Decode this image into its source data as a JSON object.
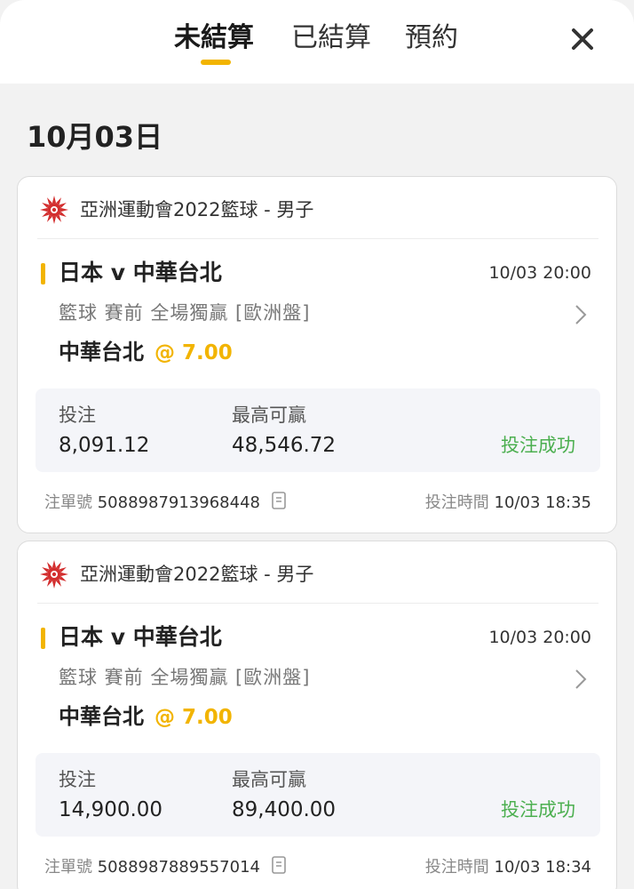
{
  "tabs": [
    {
      "label": "未結算",
      "active": true
    },
    {
      "label": "已結算",
      "active": false
    },
    {
      "label": "預約",
      "active": false
    }
  ],
  "date_heading": "10月03日",
  "colors": {
    "accent": "#f2b400",
    "success": "#4caf50",
    "league_icon": "#d32f2f"
  },
  "bets": [
    {
      "league": "亞洲運動會2022籃球 - 男子",
      "match": "日本 v 中華台北",
      "match_time": "10/03 20:00",
      "market": "籃球 賽前  全場獨贏 [歐洲盤]",
      "pick": "中華台北",
      "odds": "@ 7.00",
      "stake_label": "投注",
      "stake": "8,091.12",
      "max_win_label": "最高可贏",
      "max_win": "48,546.72",
      "status": "投注成功",
      "ticket_label": "注單號",
      "ticket_no": "5088987913968448",
      "bet_time_label": "投注時間",
      "bet_time": "10/03 18:35"
    },
    {
      "league": "亞洲運動會2022籃球 - 男子",
      "match": "日本 v 中華台北",
      "match_time": "10/03 20:00",
      "market": "籃球 賽前  全場獨贏 [歐洲盤]",
      "pick": "中華台北",
      "odds": "@ 7.00",
      "stake_label": "投注",
      "stake": "14,900.00",
      "max_win_label": "最高可贏",
      "max_win": "89,400.00",
      "status": "投注成功",
      "ticket_label": "注單號",
      "ticket_no": "5088987889557014",
      "bet_time_label": "投注時間",
      "bet_time": "10/03 18:34"
    }
  ]
}
